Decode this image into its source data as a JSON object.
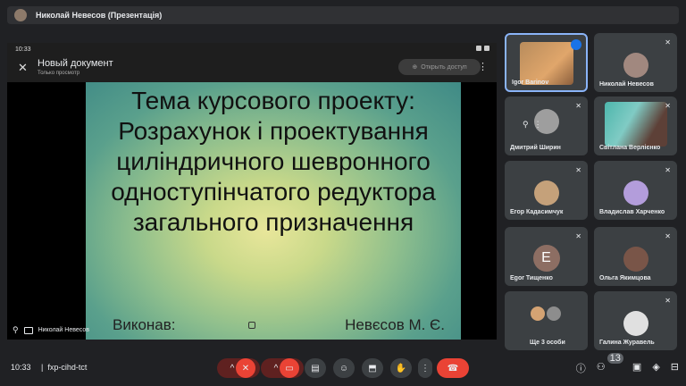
{
  "header": {
    "presenter_title": "Николай Невесов (Презентація)"
  },
  "stage": {
    "status_time": "10:33",
    "doc_title": "Новый документ",
    "doc_subtitle": "Только просмотр",
    "share_label": "Открыть доступ",
    "presenter_label": "Николай Невесов",
    "slide": {
      "lines": [
        "Тема курсового проекту:",
        "Розрахунок і проектування",
        "циліндричного шевронного",
        "одноступінчатого редуктора",
        "загального призначення"
      ],
      "footer_left": "Виконав:",
      "footer_right": "Невєсов М. Є."
    }
  },
  "participants": [
    {
      "name": "Igor Barinov",
      "speaking": true
    },
    {
      "name": "Николай Невесов"
    },
    {
      "name": "Дмитрий Ширин"
    },
    {
      "name": "Світлана Верлієнко"
    },
    {
      "name": "Егор Кадасимчук"
    },
    {
      "name": "Владислав Харченко"
    },
    {
      "name": "Egor Тищенко",
      "letter": "E"
    },
    {
      "name": "Ольга Якимцова"
    },
    {
      "name": "Ще 3 особи"
    },
    {
      "name": "Галина Журавель"
    }
  ],
  "bottom": {
    "time": "10:33",
    "separator": "|",
    "meeting_code": "fxp-cihd-tct",
    "participant_count": "13"
  },
  "icons": {
    "mic_off": "mic-off-icon",
    "camera_off": "camera-off-icon",
    "captions": "captions-icon",
    "emoji": "emoji-icon",
    "present": "present-icon",
    "raise_hand": "raise-hand-icon",
    "more": "more-vert-icon",
    "hangup": "hangup-icon"
  },
  "colors": {
    "accent": "#8ab4f8",
    "danger": "#ea4335",
    "tile_bg": "#3c4043",
    "page_bg": "#202124"
  }
}
